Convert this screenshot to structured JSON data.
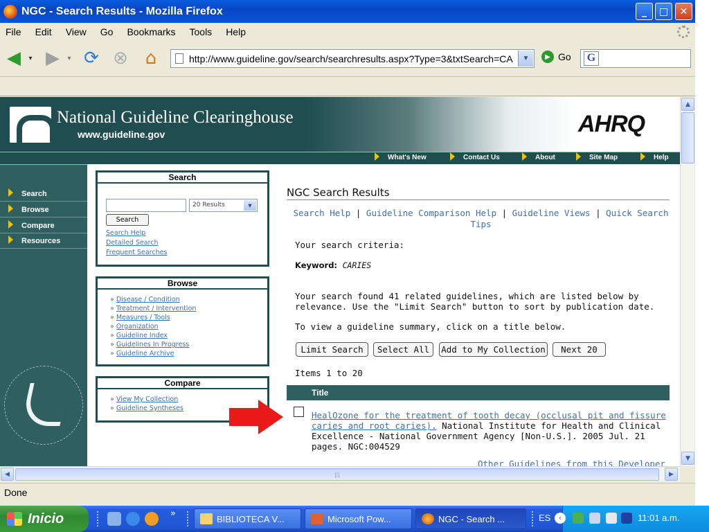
{
  "window": {
    "title": "NGC - Search Results - Mozilla Firefox",
    "min": "_",
    "max": "□",
    "close": "✕"
  },
  "menu": [
    "File",
    "Edit",
    "View",
    "Go",
    "Bookmarks",
    "Tools",
    "Help"
  ],
  "nav": {
    "url": "http://www.guideline.gov/search/searchresults.aspx?Type=3&txtSearch=CA",
    "go_label": "Go",
    "search_engine_letter": "G"
  },
  "status": "Done",
  "site": {
    "title": "National Guideline Clearinghouse",
    "url": "www.guideline.gov",
    "agency": "AHRQ",
    "topnav": [
      "What's New",
      "Contact Us",
      "About",
      "Site Map",
      "Help"
    ],
    "leftnav": [
      "Search",
      "Browse",
      "Compare",
      "Resources"
    ]
  },
  "search_box": {
    "title": "Search",
    "query": "",
    "results_select": "20 Results",
    "button": "Search",
    "links": [
      "Search Help",
      "Detailed Search",
      "Frequent Searches"
    ]
  },
  "browse_box": {
    "title": "Browse",
    "links": [
      "Disease / Condition",
      "Treatment / Intervention",
      "Measures / Tools",
      "Organization",
      "Guideline Index",
      "Guidelines In Progress",
      "Guideline Archive"
    ]
  },
  "compare_box": {
    "title": "Compare",
    "links": [
      "View My Collection",
      "Guideline Syntheses"
    ]
  },
  "main": {
    "heading": "NGC Search Results",
    "help_links": [
      "Search Help",
      "Guideline Comparison Help",
      "Guideline Views",
      "Quick Search Tips"
    ],
    "separator": "|",
    "criteria_label": "Your search criteria:",
    "keyword_label": "Keyword:",
    "keyword_value": "CARIES",
    "found_text": "Your search found 41 related guidelines, which are listed below by relevance. Use the \"Limit Search\" button to sort by publication date.",
    "view_text": "To view a guideline summary, click on a title below.",
    "buttons": [
      "Limit Search",
      "Select All",
      "Add to My Collection",
      "Next 20"
    ],
    "items_text": "Items 1 to 20",
    "table_header": "Title",
    "result_title": "HealOzone for the treatment of tooth decay (occlusal pit and fissure caries and root caries).",
    "result_details": "National Institute for Health and Clinical Excellence - National Government Agency [Non-U.S.]. 2005 Jul. 21 pages. NGC:004529",
    "other_link": "Other Guidelines from this Developer"
  },
  "taskbar": {
    "start": "Inicio",
    "chevron": "»",
    "tasks": [
      "BIBLIOTECA V...",
      "Microsoft Pow...",
      "NGC - Search ..."
    ],
    "lang": "ES",
    "clock": "11:01 a.m."
  },
  "colors": {
    "ngc_teal": "#2f5f5f",
    "link_blue": "#3d6fb8",
    "arrow_red": "#e81a1a"
  }
}
